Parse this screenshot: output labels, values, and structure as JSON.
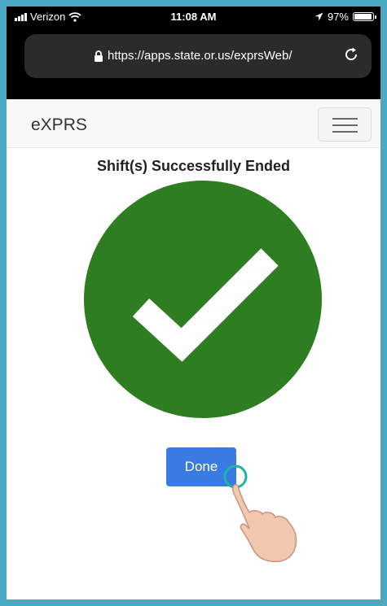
{
  "status_bar": {
    "carrier": "Verizon",
    "time": "11:08 AM",
    "battery": "97%",
    "icons": [
      "signal-icon",
      "wifi-icon",
      "location-arrow-icon",
      "battery-icon"
    ]
  },
  "browser": {
    "url": "https://apps.state.or.us/exprsWeb/",
    "icons": [
      "lock-icon",
      "reload-icon"
    ]
  },
  "navbar": {
    "brand": "eXPRS",
    "menu_icon": "hamburger-menu-icon"
  },
  "main": {
    "title": "Shift(s) Successfully Ended",
    "success_icon": "checkmark-circle-icon",
    "done_label": "Done",
    "pointer_icon": "pointing-hand-icon"
  },
  "colors": {
    "frame": "#4aa8c2",
    "success": "#2e7d20",
    "button": "#3a7be3",
    "navbar_bg": "#f8f8f8"
  }
}
